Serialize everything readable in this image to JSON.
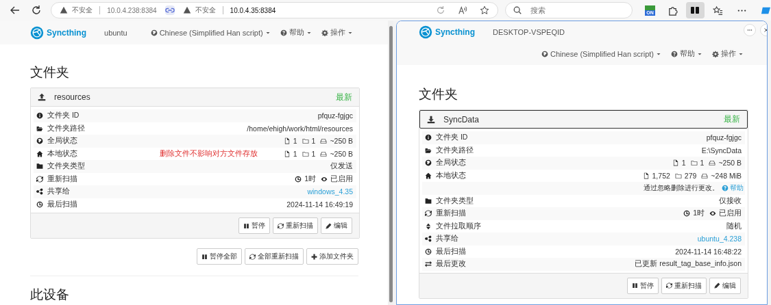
{
  "browser": {
    "addresses": [
      {
        "warning": "不安全",
        "url": "10.0.4.238:8384",
        "focused": false
      },
      {
        "warning": "不安全",
        "url": "10.0.4.35:8384",
        "focused": true
      }
    ],
    "search": {
      "placeholder": "搜索"
    },
    "extension_label": "ON"
  },
  "panes": [
    {
      "active": false,
      "brand": "Syncthing",
      "device": "ubuntu",
      "menus": [
        {
          "kind": "language",
          "label": "Chinese (Simplified Han script)"
        },
        {
          "kind": "help",
          "label": "帮助"
        },
        {
          "kind": "actions",
          "label": "操作"
        }
      ],
      "section_title": "文件夹",
      "folder": {
        "send_only": true,
        "focused": false,
        "name": "resources",
        "status": "最新",
        "rows": [
          {
            "kind": "id",
            "label": "文件夹 ID",
            "value": "pfquz-fgjgc"
          },
          {
            "kind": "path",
            "label": "文件夹路径",
            "value": "/home/ehigh/work/html/resources"
          },
          {
            "kind": "global",
            "label": "全局状态",
            "files": "1",
            "dirs": "1",
            "size": "~250 B"
          },
          {
            "kind": "local",
            "label": "本地状态",
            "files": "1",
            "dirs": "1",
            "size": "~250 B"
          },
          {
            "kind": "type",
            "label": "文件夹类型",
            "value": "仅发送"
          },
          {
            "kind": "rescan",
            "label": "重新扫描",
            "interval": "1时",
            "watcher": "已启用"
          },
          {
            "kind": "shared",
            "label": "共享给",
            "value": "windows_4.35"
          },
          {
            "kind": "scanned",
            "label": "最后扫描",
            "value": "2024-11-14 16:49:19"
          }
        ],
        "buttons": [
          {
            "kind": "pause",
            "label": "暂停"
          },
          {
            "kind": "rescan",
            "label": "重新扫描"
          },
          {
            "kind": "edit",
            "label": "编辑"
          }
        ]
      },
      "annotation": "删除文件不影响对方文件存放",
      "global_buttons": [
        {
          "kind": "pause",
          "label": "暂停全部"
        },
        {
          "kind": "rescan",
          "label": "全部重新扫描"
        },
        {
          "kind": "add",
          "label": "添加文件夹"
        }
      ],
      "next_section_title": "此设备"
    },
    {
      "active": true,
      "brand": "Syncthing",
      "device": "DESKTOP-VSPEQID",
      "menus": [
        {
          "kind": "language",
          "label": "Chinese (Simplified Han script)"
        },
        {
          "kind": "help",
          "label": "帮助"
        },
        {
          "kind": "actions",
          "label": "操作"
        }
      ],
      "section_title": "文件夹",
      "folder": {
        "send_only": false,
        "focused": true,
        "name": "SyncData",
        "status": "最新",
        "rows": [
          {
            "kind": "id",
            "label": "文件夹 ID",
            "value": "pfquz-fgjgc"
          },
          {
            "kind": "path",
            "label": "文件夹路径",
            "value": "E:\\SyncData"
          },
          {
            "kind": "global",
            "label": "全局状态",
            "files": "1",
            "dirs": "1",
            "size": "~250 B"
          },
          {
            "kind": "local",
            "label": "本地状态",
            "files": "1,752",
            "dirs": "279",
            "size": "~248 MiB"
          },
          {
            "kind": "note",
            "value": "通过忽略删除进行更改。",
            "link": "帮助"
          },
          {
            "kind": "type",
            "label": "文件夹类型",
            "value": "仅接收"
          },
          {
            "kind": "rescan",
            "label": "重新扫描",
            "interval": "1时",
            "watcher": "已启用"
          },
          {
            "kind": "order",
            "label": "文件拉取顺序",
            "value": "随机"
          },
          {
            "kind": "shared",
            "label": "共享给",
            "value": "ubuntu_4.238"
          },
          {
            "kind": "scanned",
            "label": "最后扫描",
            "value": "2024-11-14 16:48:22"
          },
          {
            "kind": "changed",
            "label": "最后更改",
            "value": "已更新 result_tag_base_info.json"
          }
        ],
        "buttons": [
          {
            "kind": "pause",
            "label": "暂停"
          },
          {
            "kind": "rescan",
            "label": "重新扫描"
          },
          {
            "kind": "edit",
            "label": "编辑"
          }
        ]
      }
    }
  ]
}
